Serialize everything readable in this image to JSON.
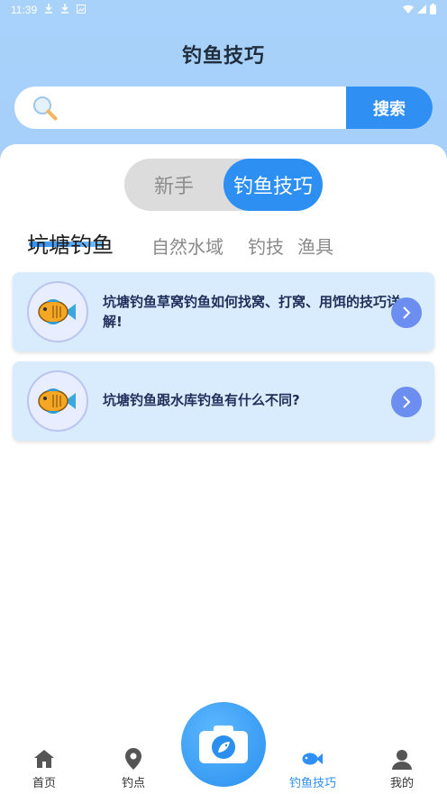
{
  "status_bar": {
    "time": "11:39",
    "left_icons": [
      "download-icon",
      "download-icon",
      "image-icon"
    ],
    "right_icons": [
      "wifi-icon",
      "signal-icon",
      "battery-icon"
    ]
  },
  "header": {
    "title": "钓鱼技巧"
  },
  "search": {
    "placeholder": "",
    "value": "",
    "button_label": "搜索"
  },
  "segment": {
    "left_label": "新手",
    "right_label": "钓鱼技巧",
    "active": "right"
  },
  "categories": [
    {
      "label": "坑塘钓鱼",
      "active": true
    },
    {
      "label": "自然水域",
      "active": false
    },
    {
      "label": "钓技",
      "active": false
    },
    {
      "label": "渔具",
      "active": false
    }
  ],
  "articles": [
    {
      "title": "坑塘钓鱼草窝钓鱼如何找窝、打窝、用饵的技巧详解!"
    },
    {
      "title": "坑塘钓鱼跟水库钓鱼有什么不同?"
    }
  ],
  "bottom_nav": [
    {
      "label": "首页",
      "icon": "home-icon",
      "active": false
    },
    {
      "label": "钓点",
      "icon": "location-pin-icon",
      "active": false
    },
    {
      "label": "钓鱼技巧",
      "icon": "fish-icon",
      "active": true
    },
    {
      "label": "我的",
      "icon": "user-icon",
      "active": false
    }
  ],
  "colors": {
    "header_bg": "#a9d2fb",
    "accent": "#2f8ff3",
    "card_bg": "#d8ecfd",
    "arrow_bg": "#6c8ef0"
  }
}
